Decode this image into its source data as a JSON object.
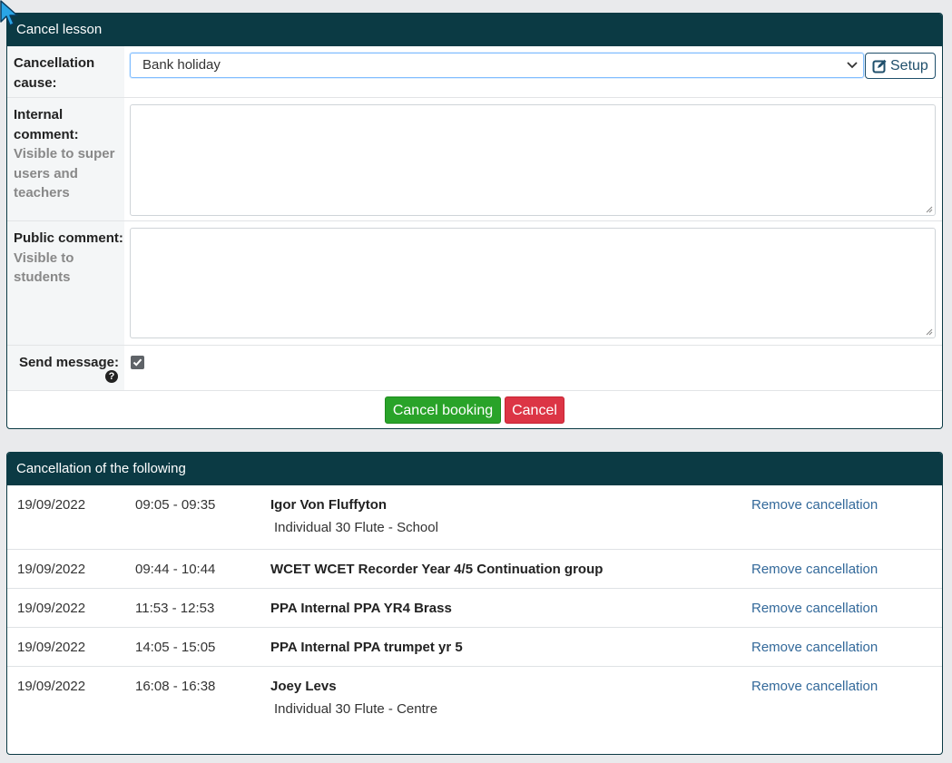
{
  "cancel_panel": {
    "title": "Cancel lesson",
    "cause_label": "Cancellation cause:",
    "cause_value": "Bank holiday",
    "setup_label": "Setup",
    "internal_label": "Internal comment:",
    "internal_hint": "Visible to super users and teachers",
    "public_label": "Public comment:",
    "public_hint": "Visible to students",
    "send_label": "Send message:",
    "send_checked": true,
    "help_glyph": "?",
    "confirm_button": "Cancel booking",
    "cancel_button": "Cancel"
  },
  "list_panel": {
    "title": "Cancellation of the following",
    "rows": [
      {
        "date": "19/09/2022",
        "time": "09:05 - 09:35",
        "title": "Igor Von Fluffyton",
        "subtitle": "Individual 30 Flute - School",
        "action": "Remove cancellation"
      },
      {
        "date": "19/09/2022",
        "time": "09:44 - 10:44",
        "title": "WCET WCET Recorder Year 4/5 Continuation group",
        "action": "Remove cancellation"
      },
      {
        "date": "19/09/2022",
        "time": "11:53 - 12:53",
        "title": "PPA Internal PPA YR4 Brass",
        "action": "Remove cancellation"
      },
      {
        "date": "19/09/2022",
        "time": "14:05 - 15:05",
        "title": "PPA Internal PPA trumpet yr 5",
        "action": "Remove cancellation"
      },
      {
        "date": "19/09/2022",
        "time": "16:08 - 16:38",
        "title": "Joey Levs",
        "subtitle": "Individual 30 Flute - Centre",
        "action": "Remove cancellation"
      }
    ]
  },
  "colors": {
    "header": "#0b3a44",
    "confirm": "#29a329",
    "cancel": "#dc3545",
    "link": "#33699a"
  },
  "icons": {
    "cursor": "mouse-pointer-icon",
    "setup": "edit-square-icon",
    "dropdown": "chevron-down-icon",
    "help": "question-circle-icon",
    "checkbox": "check-icon"
  }
}
